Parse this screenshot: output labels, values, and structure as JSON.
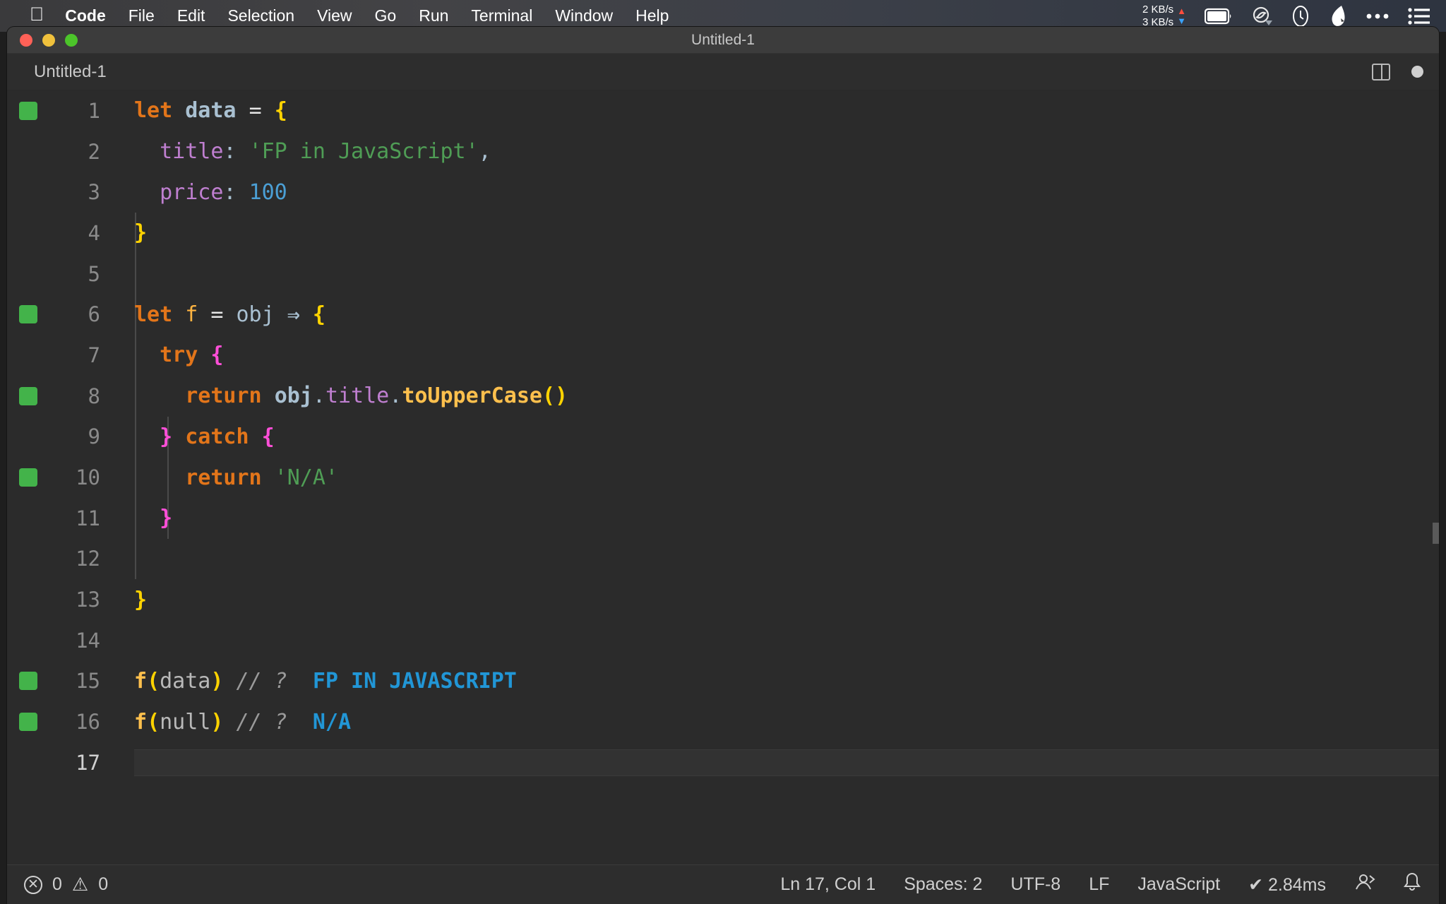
{
  "menubar": {
    "apple": "",
    "items": [
      {
        "label": "Code",
        "bold": true
      },
      {
        "label": "File",
        "bold": false
      },
      {
        "label": "Edit",
        "bold": false
      },
      {
        "label": "Selection",
        "bold": false
      },
      {
        "label": "View",
        "bold": false
      },
      {
        "label": "Go",
        "bold": false
      },
      {
        "label": "Run",
        "bold": false
      },
      {
        "label": "Terminal",
        "bold": false
      },
      {
        "label": "Window",
        "bold": false
      },
      {
        "label": "Help",
        "bold": false
      }
    ],
    "network": {
      "up": "2 KB/s",
      "down": "3 KB/s",
      "up_arrow": "▲",
      "down_arrow": "▼"
    }
  },
  "window": {
    "title": "Untitled-1",
    "tab_label": "Untitled-1"
  },
  "editor": {
    "lines": [
      {
        "n": "1",
        "marker": true,
        "text": "let data = {"
      },
      {
        "n": "2",
        "marker": false,
        "text": "  title: 'FP in JavaScript',"
      },
      {
        "n": "3",
        "marker": false,
        "text": "  price: 100"
      },
      {
        "n": "4",
        "marker": false,
        "text": "}"
      },
      {
        "n": "5",
        "marker": false,
        "text": ""
      },
      {
        "n": "6",
        "marker": true,
        "text": "let f = obj ⇒ {"
      },
      {
        "n": "7",
        "marker": false,
        "text": "  try {"
      },
      {
        "n": "8",
        "marker": true,
        "text": "    return obj.title.toUpperCase()"
      },
      {
        "n": "9",
        "marker": false,
        "text": "  } catch {"
      },
      {
        "n": "10",
        "marker": true,
        "text": "    return 'N/A'"
      },
      {
        "n": "11",
        "marker": false,
        "text": "  }"
      },
      {
        "n": "12",
        "marker": false,
        "text": ""
      },
      {
        "n": "13",
        "marker": false,
        "text": "}"
      },
      {
        "n": "14",
        "marker": false,
        "text": ""
      },
      {
        "n": "15",
        "marker": true,
        "text": "f(data) // ?  FP IN JAVASCRIPT"
      },
      {
        "n": "16",
        "marker": true,
        "text": "f(null) // ?  N/A"
      },
      {
        "n": "17",
        "marker": false,
        "text": ""
      }
    ],
    "inline_results": {
      "line15": "FP IN JAVASCRIPT",
      "line16": "N/A",
      "comment": "// ?"
    }
  },
  "statusbar": {
    "errors": "0",
    "warnings": "0",
    "position": "Ln 17, Col 1",
    "spaces": "Spaces: 2",
    "encoding": "UTF-8",
    "eol": "LF",
    "language": "JavaScript",
    "quokka": "✔ 2.84ms",
    "error_icon": "⊗",
    "warning_icon": "⚠"
  },
  "colors": {
    "keyword": "#e2751a",
    "string": "#4f9d55",
    "number": "#4b9fd5",
    "property": "#bf7fd0",
    "function": "#ffc04d",
    "brace1": "#ffd300",
    "brace2": "#ff4fd8",
    "result": "#2196d6",
    "marker_green": "#43b34a"
  }
}
